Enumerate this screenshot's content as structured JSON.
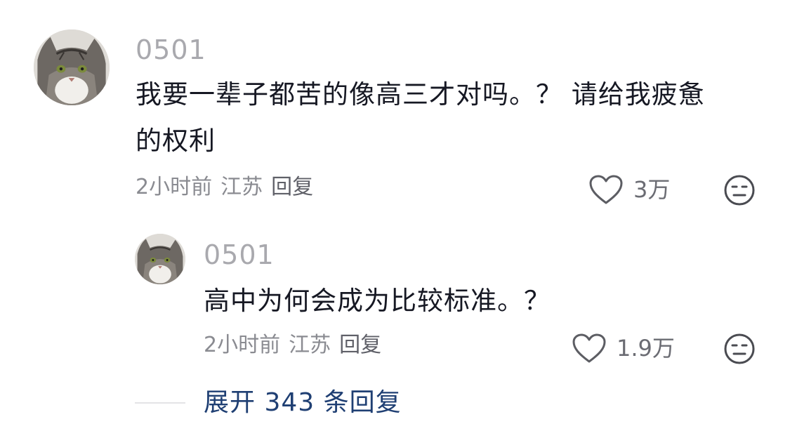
{
  "comment": {
    "username": "0501",
    "text_line1": "我要一辈子都苦的像高三才对吗。？ 请给我疲惫",
    "text_line2": "的权利",
    "time": "2小时前",
    "location": "江苏",
    "reply_label": "回复",
    "like_count": "3万",
    "avatar_icon": "cat-avatar-icon"
  },
  "reply": {
    "username": "0501",
    "text": "高中为何会成为比较标准。？",
    "time": "2小时前",
    "location": "江苏",
    "reply_label": "回复",
    "like_count": "1.9万",
    "avatar_icon": "cat-avatar-icon"
  },
  "expand": {
    "label": "展开 343 条回复"
  },
  "colors": {
    "username": "#a9a9ae",
    "text": "#161823",
    "meta": "#8a8b91",
    "expand_link": "#1f3f73"
  }
}
